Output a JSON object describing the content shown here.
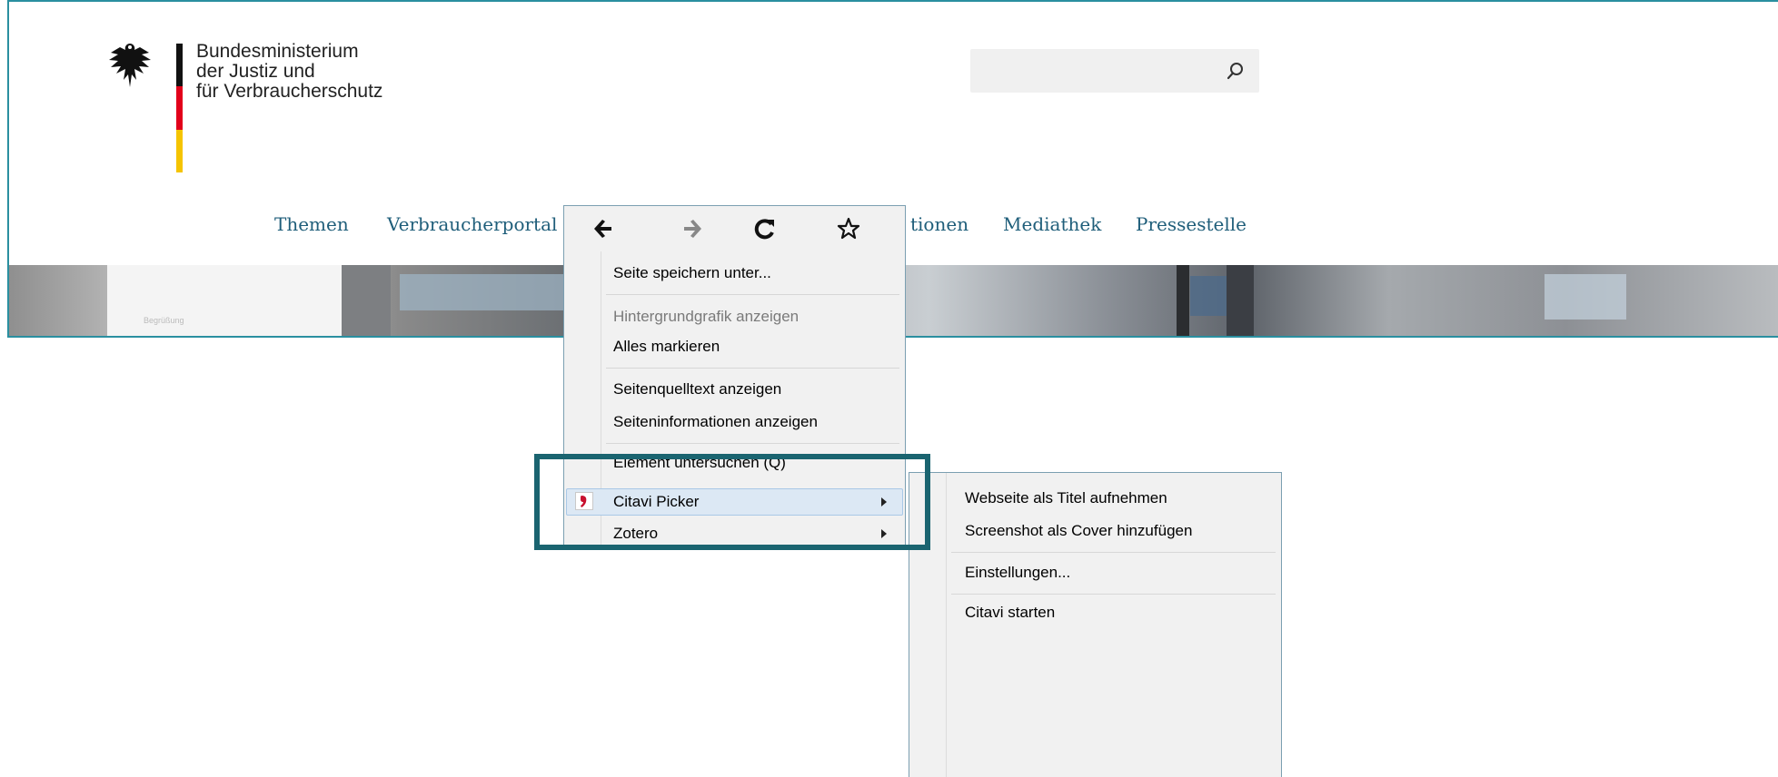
{
  "site": {
    "org_lines": [
      "Bundesministerium",
      "der Justiz und",
      "für Verbraucherschutz"
    ],
    "nav": [
      "Themen",
      "Verbraucherportal",
      "tionen",
      "Mediathek",
      "Pressestelle"
    ],
    "hero_caption": "Begrüßung"
  },
  "context_menu": {
    "nav_icons": [
      "back-arrow-icon",
      "forward-arrow-icon",
      "reload-icon",
      "bookmark-star-icon"
    ],
    "items": [
      {
        "label": "Seite speichern unter...",
        "disabled": false
      },
      {
        "label": "Hintergrundgrafik anzeigen",
        "disabled": true
      },
      {
        "label": "Alles markieren",
        "disabled": false
      },
      {
        "label": "Seitenquelltext anzeigen",
        "disabled": false
      },
      {
        "label": "Seiteninformationen anzeigen",
        "disabled": false
      },
      {
        "label": "Element untersuchen (Q)",
        "disabled": false
      },
      {
        "label": "Citavi Picker",
        "submenu": true,
        "highlighted": true
      },
      {
        "label": "Zotero",
        "submenu": true
      }
    ]
  },
  "submenu": {
    "items": [
      {
        "label": "Webseite als Titel aufnehmen"
      },
      {
        "label": "Screenshot als Cover hinzufügen"
      },
      {
        "label": "Einstellungen..."
      },
      {
        "label": "Citavi starten"
      }
    ]
  },
  "colors": {
    "accent": "#1a6470",
    "nav_text": "#1f5e7a",
    "citavi": "#c8102e"
  }
}
